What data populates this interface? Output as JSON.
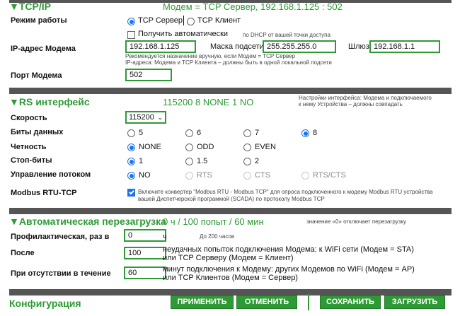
{
  "tcpip": {
    "title": "▼TCP/IP",
    "status": "Модем = TCP Сервер, 192.168.1.125 : 502",
    "mode_label": "Режим работы",
    "mode_server": "TCP Сервер",
    "mode_client": "TCP Клиент",
    "auto_label": "Получить автоматически",
    "auto_hint": "по DHCP от вашей точки доступа",
    "ip_label": "IP-адрес Модема",
    "ip_value": "192.168.1.125",
    "mask_label": "Маска подсети",
    "mask_value": "255.255.255.0",
    "gw_label": "Шлюз",
    "gw_value": "192.168.1.1",
    "ip_note1": "Рекомендуется назначение вручную, если Модем = TCP Сервер",
    "ip_note2": "IP-адреса: Модема и TCP Клиента – должны быть в одной локальной подсети",
    "port_label": "Порт Модема",
    "port_value": "502"
  },
  "rs": {
    "title": "▼RS интерфейс",
    "status": "115200 8 NONE 1 NO",
    "note1": "Настройки интерфейса: Модема и подключаемого",
    "note2": "к нему Устройства – должны совпадать",
    "speed_label": "Скорость",
    "speed_value": "115200",
    "bits_label": "Биты данных",
    "bits": [
      "5",
      "6",
      "7",
      "8"
    ],
    "parity_label": "Четность",
    "parity": [
      "NONE",
      "ODD",
      "EVEN"
    ],
    "stop_label": "Стоп-биты",
    "stop": [
      "1",
      "1.5",
      "2"
    ],
    "flow_label": "Управление потоком",
    "flow": [
      "NO",
      "RTS",
      "CTS",
      "RTS/CTS"
    ],
    "modbus_label": "Modbus RTU-TCP",
    "modbus_text1": "Включите конвертер \"Modbus RTU - Modbus TCP\" для опроса подключенного к модему Modbus RTU устройства",
    "modbus_text2": "вашей Диспетчерской программой (SCADA) по протоколу Modbus TCP"
  },
  "reboot": {
    "title": "▼Автоматическая перезагрузка",
    "status": "0 ч / 100 попыт / 60 мин",
    "note": "значение «0» отключает перезагрузку",
    "prof_label": "Профилактическая, раз в",
    "prof_value": "0",
    "prof_unit": "ч",
    "prof_hint": "До 200 часов",
    "after_label": "После",
    "after_value": "100",
    "after_text1": "неудачных попыток подключения Модема: к WiFi сети (Модем = STA)",
    "after_text2": "или TCP Серверу (Модем = Клиент)",
    "absent_label": "При отсутствии в течение",
    "absent_value": "60",
    "absent_text1": "минут подключения к Модему: других Модемов по WiFi (Модем = AP)",
    "absent_text2": "или TCP Клиентов (Модем = Сервер)"
  },
  "config": {
    "title": "Конфигурация",
    "apply": "ПРИМЕНИТЬ",
    "cancel": "ОТМЕНИТЬ",
    "save": "СОХРАНИТЬ",
    "load": "ЗАГРУЗИТЬ"
  },
  "colors": {
    "accent": "#2e9a35",
    "bar": "#555555",
    "radio": "#1a73e8"
  }
}
